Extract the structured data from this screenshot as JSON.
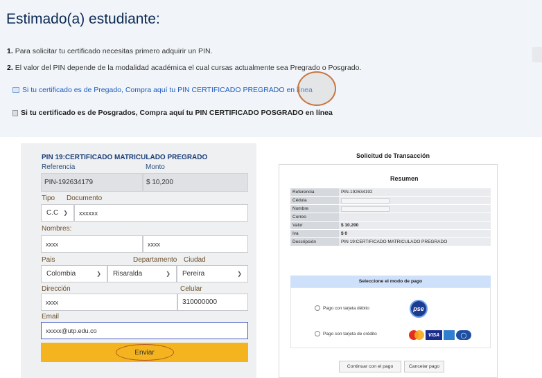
{
  "header": {
    "title": "Estimado(a) estudiante:",
    "instructions": [
      {
        "num": "1.",
        "text": "Para solicitar tu certificado necesitas primero adquirir un PIN."
      },
      {
        "num": "2.",
        "text": "El valor del PIN depende de la modalidad académica el cual cursas actualmente sea Pregrado o Posgrado."
      }
    ],
    "link_pregrado": "Si tu certificado es de Pregado, Compra aquí tu PIN CERTIFICADO PREGRADO en línea",
    "link_posgrado": "Si tu certificado es de Posgrados, Compra aquí tu PIN CERTIFICADO POSGRADO en línea"
  },
  "form": {
    "title": "PIN 19:CERTIFICADO MATRICULADO PREGRADO",
    "referencia_label": "Referencia",
    "referencia_value": "PIN-192634179",
    "monto_label": "Monto",
    "monto_value": "$ 10,200",
    "tipo_label": "Tipo",
    "tipo_value": "C.C",
    "documento_label": "Documento",
    "documento_value": "xxxxxx",
    "nombres_label": "Nombres:",
    "nombre1_value": "xxxx",
    "nombre2_value": "xxxx",
    "pais_label": "Pais",
    "pais_value": "Colombia",
    "departamento_label": "Departamento",
    "departamento_value": "Risaralda",
    "ciudad_label": "Ciudad",
    "ciudad_value": "Pereira",
    "direccion_label": "Dirección",
    "direccion_value": "xxxx",
    "celular_label": "Celular",
    "celular_value": "310000000",
    "email_label": "Email",
    "email_value": "xxxxx@utp.edu.co",
    "submit_label": "Enviar"
  },
  "receipt": {
    "title": "Solicitud de Transacción",
    "summary_title": "Resumen",
    "rows": [
      {
        "key": "Referencia",
        "value": "PIN-192634192"
      },
      {
        "key": "Cédula",
        "value": ""
      },
      {
        "key": "Nombre",
        "value": ""
      },
      {
        "key": "Correo",
        "value": ""
      },
      {
        "key": "Valor",
        "value": "$ 10.200"
      },
      {
        "key": "Iva",
        "value": "$ 0"
      },
      {
        "key": "Descripción",
        "value": "PIN 19:CERTIFICADO MATRICULADO PREGRADO"
      }
    ],
    "payment_header": "Seleccione el modo de pago",
    "debit_label": "Pago con tarjeta débito",
    "credit_label": "Pago con tarjeta de crédito",
    "pse_logo": "pse",
    "visa_logo": "VISA",
    "continue_button": "Continuar con el pago",
    "cancel_button": "Cancelar pago"
  }
}
